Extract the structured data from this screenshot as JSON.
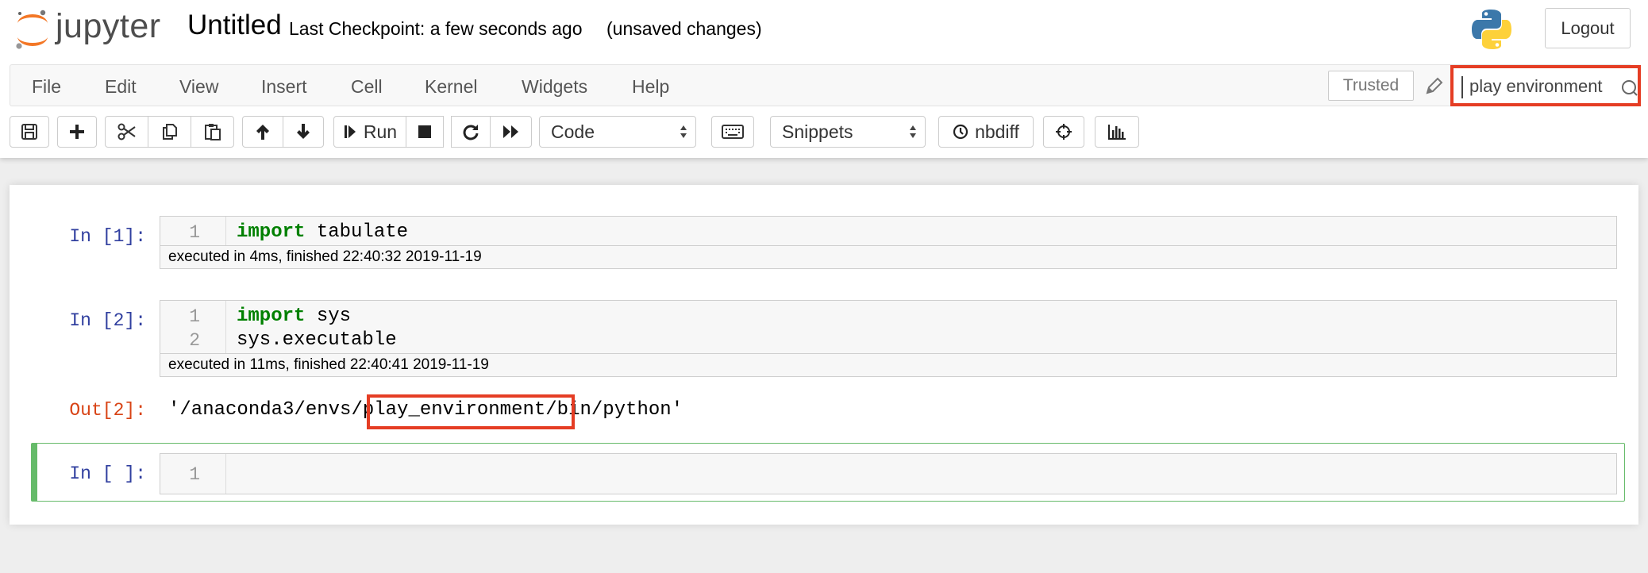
{
  "header": {
    "logo_text": "jupyter",
    "notebook_name": "Untitled",
    "checkpoint": "Last Checkpoint: a few seconds ago",
    "autosave": "(unsaved changes)",
    "logout_label": "Logout"
  },
  "menubar": {
    "items": [
      "File",
      "Edit",
      "View",
      "Insert",
      "Cell",
      "Kernel",
      "Widgets",
      "Help"
    ],
    "trusted_label": "Trusted",
    "search_value": "play environment"
  },
  "toolbar": {
    "run_label": "Run",
    "cell_type": "Code",
    "snippets": "Snippets",
    "nbdiff_label": "nbdiff"
  },
  "cells": [
    {
      "prompt": "In [1]:",
      "line_numbers": [
        "1"
      ],
      "keyword": "import",
      "code_rest": " tabulate",
      "exec_time": "executed in 4ms, finished 22:40:32 2019-11-19"
    },
    {
      "prompt": "In [2]:",
      "line_numbers": [
        "1",
        "2"
      ],
      "keyword": "import",
      "code_rest": " sys",
      "code_line2": "sys.executable",
      "exec_time": "executed in 11ms, finished 22:40:41 2019-11-19",
      "out_prompt": "Out[2]:",
      "output_prefix": "'/anaconda3/envs/",
      "output_highlight": "play_environment",
      "output_suffix": "/bin/python'"
    },
    {
      "prompt": "In [ ]:",
      "line_numbers": [
        "1"
      ]
    }
  ],
  "colors": {
    "highlight_box": "#e53d24",
    "in_prompt": "#303f9f",
    "out_prompt": "#d84315",
    "selected_cell_border": "#66bb6a",
    "keyword": "#008000"
  }
}
